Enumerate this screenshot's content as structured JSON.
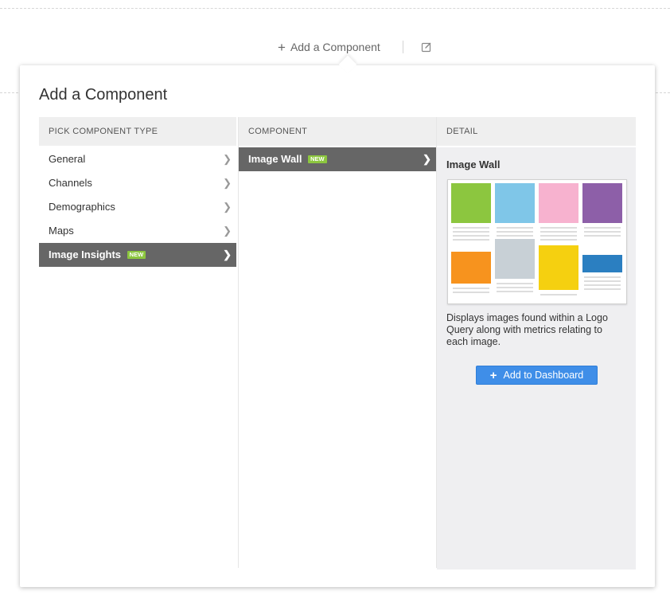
{
  "topbar": {
    "add_component_label": "Add a Component",
    "plus_icon": "+",
    "edit_icon": "edit-icon"
  },
  "dialog": {
    "title": "Add a Component",
    "columns": {
      "type_header": "PICK COMPONENT TYPE",
      "component_header": "COMPONENT",
      "detail_header": "DETAIL"
    },
    "types": [
      {
        "label": "General",
        "badge": ""
      },
      {
        "label": "Channels",
        "badge": ""
      },
      {
        "label": "Demographics",
        "badge": ""
      },
      {
        "label": "Maps",
        "badge": ""
      },
      {
        "label": "Image Insights",
        "badge": "NEW",
        "selected": true
      }
    ],
    "components": [
      {
        "label": "Image Wall",
        "badge": "NEW",
        "selected": true
      }
    ],
    "detail": {
      "title": "Image Wall",
      "description": "Displays images found within a Logo Query along with metrics relating to each image.",
      "add_button_label": "Add to Dashboard",
      "preview_tile_colors": [
        "#8cc63f",
        "#7fc6e8",
        "#f7b2cf",
        "#8d5fa8",
        "#f7931e",
        "#c8d0d6",
        "#f5d010",
        "#2b7fc1"
      ]
    },
    "accent_color": "#3f8ee8",
    "badge_color": "#8cc63f",
    "selected_row_color": "#666666"
  }
}
